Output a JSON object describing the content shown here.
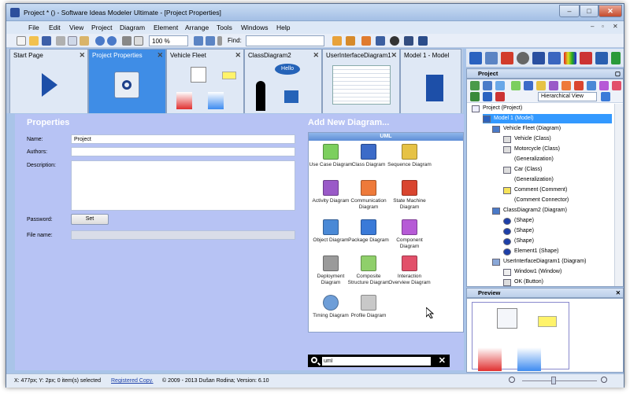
{
  "window": {
    "title": "Project * () - Software Ideas Modeler Ultimate - [Project Properties]",
    "min": "–",
    "max": "□",
    "close": "✕"
  },
  "menu": [
    "File",
    "Edit",
    "View",
    "Project",
    "Diagram",
    "Element",
    "Arrange",
    "Tools",
    "Windows",
    "Help"
  ],
  "mdi_controls": {
    "min": "–",
    "restore": "▫",
    "close": "✕"
  },
  "toolbar": {
    "zoom": "100 %",
    "find_label": "Find:"
  },
  "tabs": [
    "Start Page",
    "Project Properties",
    "Vehicle Fleet",
    "ClassDiagram2",
    "UserInterfaceDiagram1",
    "Model 1 - Model"
  ],
  "properties": {
    "heading": "Properties",
    "name_label": "Name:",
    "name_value": "Project",
    "authors_label": "Authors:",
    "description_label": "Description:",
    "password_label": "Password:",
    "set_button": "Set",
    "filename_label": "File name:"
  },
  "add_diagram": {
    "heading": "Add New Diagram...",
    "group": "UML",
    "items": [
      "Use Case Diagram",
      "Class Diagram",
      "Sequence Diagram",
      "Activity Diagram",
      "Communication Diagram",
      "State Machine Diagram",
      "Object Diagram",
      "Package Diagram",
      "Component Diagram",
      "Deployment Diagram",
      "Composite Structure Diagram",
      "Interaction Overview Diagram",
      "Timing Diagram",
      "Profile Diagram"
    ]
  },
  "search": {
    "value": "uml"
  },
  "project_panel": {
    "title": "Project",
    "view": "Hierarchical View"
  },
  "tree": [
    "Project (Project)",
    "Model 1 (Model)",
    "Vehicle Fleet (Diagram)",
    "Vehicle (Class)",
    "Motorcycle (Class)",
    "(Generalization)",
    "Car (Class)",
    "(Generalization)",
    "Comment (Comment)",
    "(Comment Connector)",
    "ClassDiagram2 (Diagram)",
    "(Shape)",
    "(Shape)",
    "(Shape)",
    "Element1 (Shape)",
    "UserInterfaceDiagram1 (Diagram)",
    "Window1 (Window)",
    "OK (Button)"
  ],
  "preview": {
    "title": "Preview"
  },
  "status": {
    "coords": "X: 477px; Y: 2px; 0 item(s) selected",
    "registered": "Registered Copy.",
    "copyright": "© 2009 - 2013 Dušan Rodina; Version: 6.10"
  },
  "colors": {
    "accent": "#3f8de6",
    "content_bg": "#b7c3f4",
    "selection": "#3399ff"
  }
}
